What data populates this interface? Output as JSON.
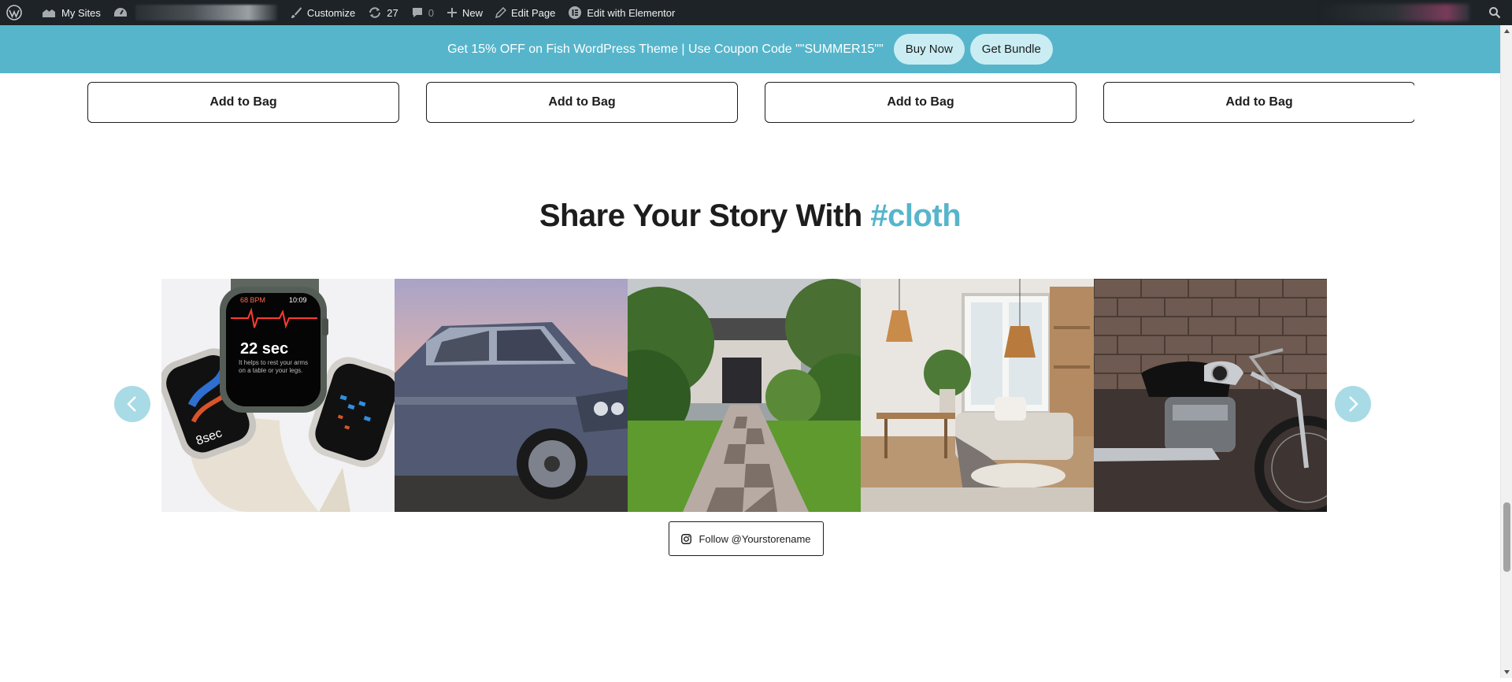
{
  "adminbar": {
    "my_sites": "My Sites",
    "customize": "Customize",
    "updates_count": "27",
    "comments_count": "0",
    "new": "New",
    "edit_page": "Edit Page",
    "edit_elementor": "Edit with Elementor"
  },
  "promo": {
    "text": "Get 15% OFF on Fish WordPress Theme | Use Coupon Code \"\"SUMMER15\"\"",
    "buy_now": "Buy Now",
    "get_bundle": "Get Bundle"
  },
  "products": {
    "add_to_bag": [
      "Add to Bag",
      "Add to Bag",
      "Add to Bag",
      "Add to Bag"
    ]
  },
  "share": {
    "heading_main": "Share Your Story With ",
    "heading_hash": "#cloth"
  },
  "gallery": {
    "images": [
      "apple-watch-photo",
      "luxury-suv-photo",
      "garden-path-photo",
      "living-room-photo",
      "motorcycle-photo"
    ],
    "watch_bpm": "68 BPM",
    "watch_time": "10:09",
    "watch_sec": "22 sec",
    "watch_hint": "It helps to rest your arms on a table or your legs.",
    "watch_small": "8sec",
    "follow_label": "Follow @Yourstorename"
  },
  "colors": {
    "accent": "#56b5cb",
    "adminbar": "#1d2327",
    "arrow": "#a8dbe5"
  }
}
